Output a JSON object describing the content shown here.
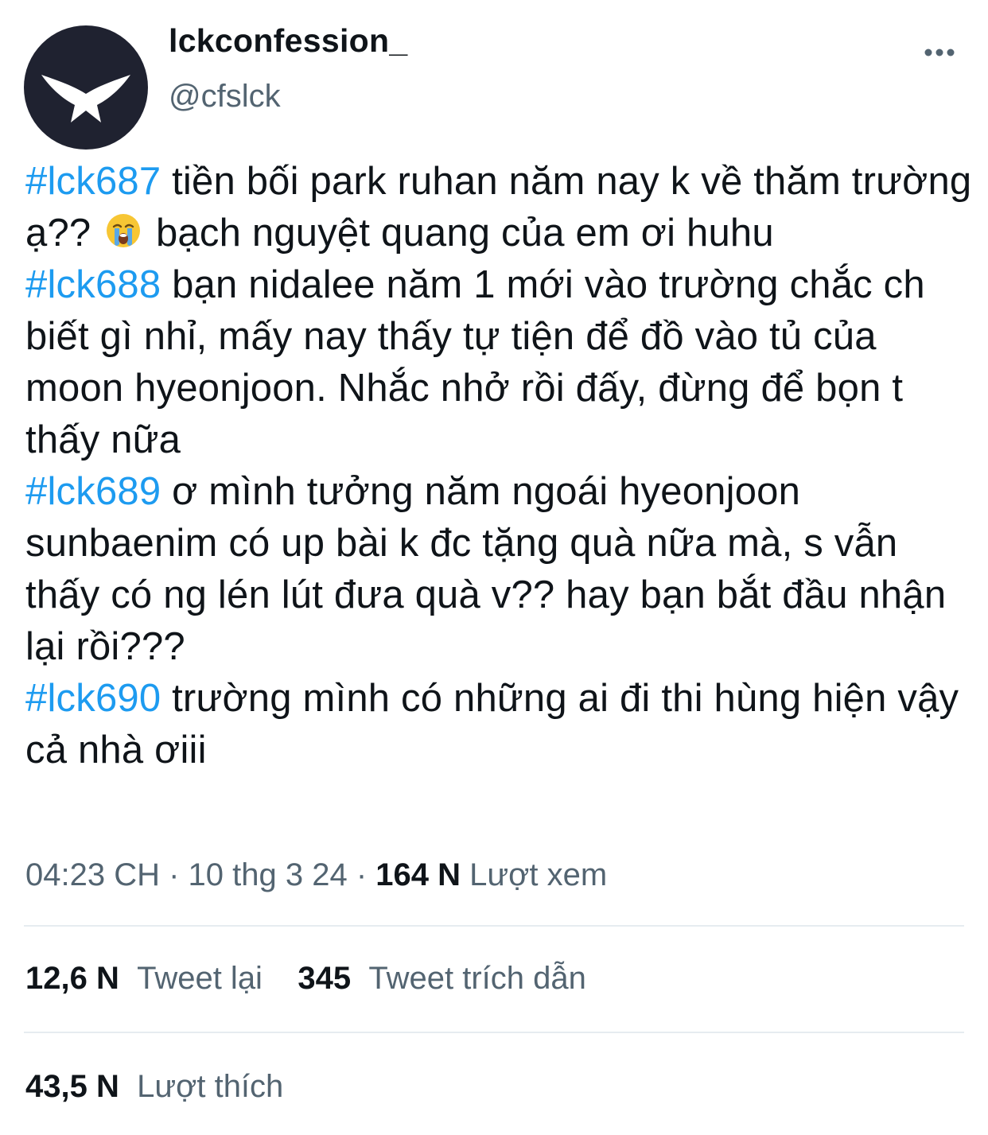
{
  "author": {
    "name": "lckconfession_",
    "handle": "@cfslck"
  },
  "icons": {
    "avatar": "bird-logo-icon",
    "more": "more-options-icon",
    "emoji": "loudly-crying-face-emoji"
  },
  "colors": {
    "hashtag": "#1d9bf0",
    "secondary_text": "#536471",
    "avatar_bg": "#1f2230"
  },
  "tweet": {
    "paragraphs": [
      {
        "tag": "#lck687",
        "text_a": " tiền bối park ruhan năm nay k về thăm trường ạ?? ",
        "text_b": "  bạch nguyệt quang của em ơi huhu"
      },
      {
        "tag": "#lck688",
        "text": " bạn nidalee năm 1 mới vào trường chắc ch biết gì nhỉ, mấy nay thấy tự tiện để đồ vào tủ của moon hyeonjoon. Nhắc nhở rồi đấy, đừng để bọn t thấy nữa"
      },
      {
        "tag": "#lck689",
        "text": " ơ mình tưởng năm ngoái hyeonjoon sunbaenim có up bài k đc tặng quà nữa mà, s vẫn thấy có ng lén lút đưa quà v?? hay bạn bắt đầu nhận lại rồi???"
      },
      {
        "tag": "#lck690",
        "text": " trường mình có những ai đi thi hùng hiện vậy cả nhà ơiii"
      }
    ]
  },
  "meta": {
    "time": "04:23 CH",
    "separator1": " · ",
    "date": "10 thg 3 24",
    "separator2": " · ",
    "views_count": "164 N",
    "views_label": "  Lượt xem"
  },
  "stats": {
    "retweets_count": "12,6 N",
    "retweets_label": "Tweet lại",
    "quotes_count": "345",
    "quotes_label": "Tweet trích dẫn",
    "likes_count": "43,5 N",
    "likes_label": "Lượt thích"
  }
}
